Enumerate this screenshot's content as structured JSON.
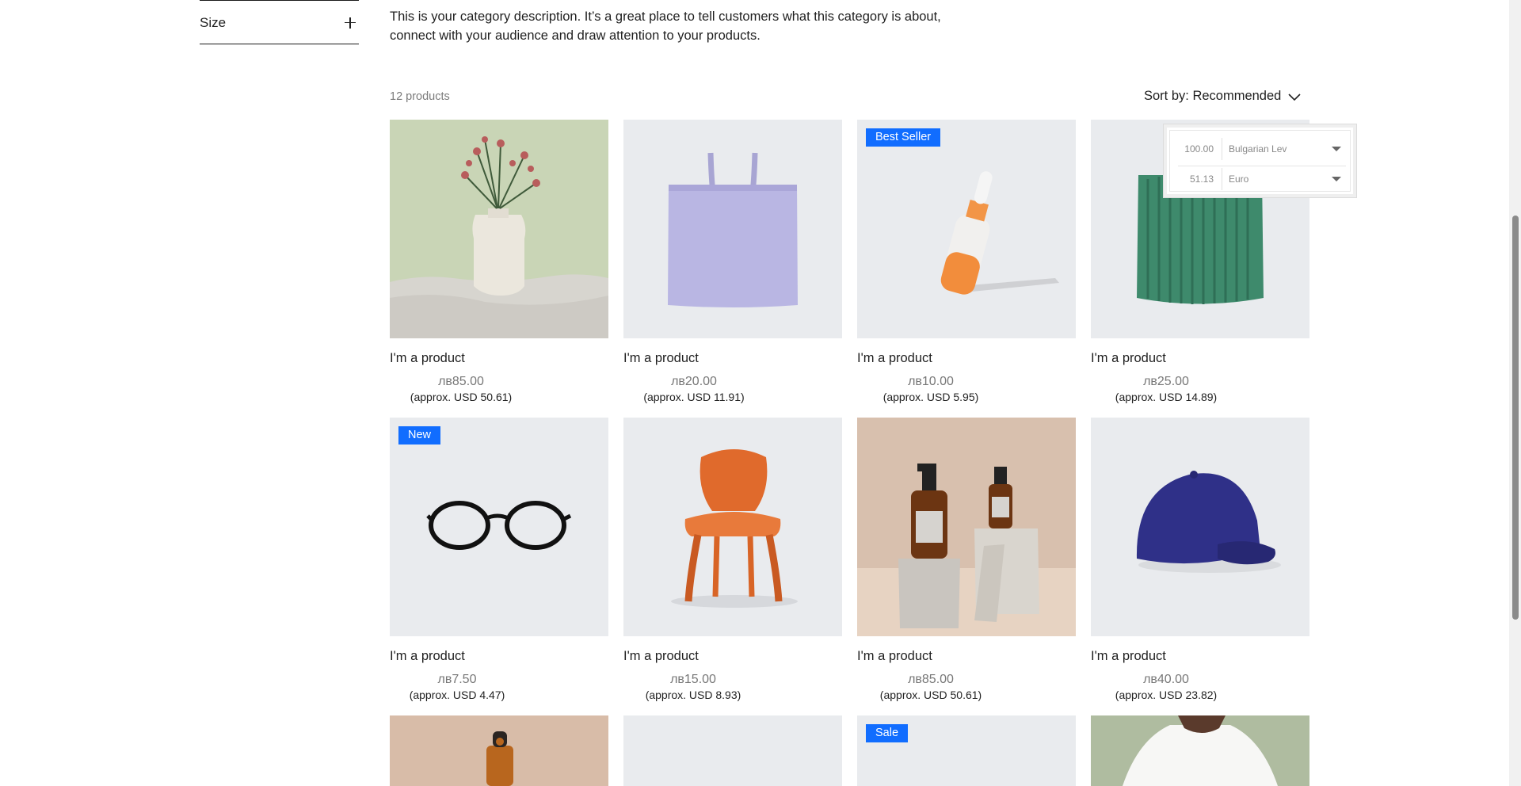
{
  "filter": {
    "size_label": "Size"
  },
  "category": {
    "description": "This is your category description. It’s a great place to tell customers what this category is about, connect with your audience and draw attention to your products."
  },
  "toolbar": {
    "product_count": "12 products",
    "sort_label": "Sort by: Recommended"
  },
  "products": [
    {
      "name": "I'm a product",
      "price": "лв85.00",
      "approx": "(approx. USD 50.61)",
      "badge": ""
    },
    {
      "name": "I'm a product",
      "price": "лв20.00",
      "approx": "(approx. USD 11.91)",
      "badge": ""
    },
    {
      "name": "I'm a product",
      "price": "лв10.00",
      "approx": "(approx. USD 5.95)",
      "badge": "Best Seller"
    },
    {
      "name": "I'm a product",
      "price": "лв25.00",
      "approx": "(approx. USD 14.89)",
      "badge": ""
    },
    {
      "name": "I'm a product",
      "price": "лв7.50",
      "approx": "(approx. USD 4.47)",
      "badge": "New"
    },
    {
      "name": "I'm a product",
      "price": "лв15.00",
      "approx": "(approx. USD 8.93)",
      "badge": ""
    },
    {
      "name": "I'm a product",
      "price": "лв85.00",
      "approx": "(approx. USD 50.61)",
      "badge": ""
    },
    {
      "name": "I'm a product",
      "price": "лв40.00",
      "approx": "(approx. USD 23.82)",
      "badge": ""
    },
    {
      "name": "",
      "price": "",
      "approx": "",
      "badge": ""
    },
    {
      "name": "",
      "price": "",
      "approx": "",
      "badge": ""
    },
    {
      "name": "",
      "price": "",
      "approx": "",
      "badge": "Sale"
    },
    {
      "name": "",
      "price": "",
      "approx": "",
      "badge": ""
    }
  ],
  "converter": {
    "row1": {
      "amount": "100.00",
      "currency": "Bulgarian Lev"
    },
    "row2": {
      "amount": "51.13",
      "currency": "Euro"
    }
  },
  "colors": {
    "badge": "#116dff",
    "image_bg": "#e9ebee"
  }
}
